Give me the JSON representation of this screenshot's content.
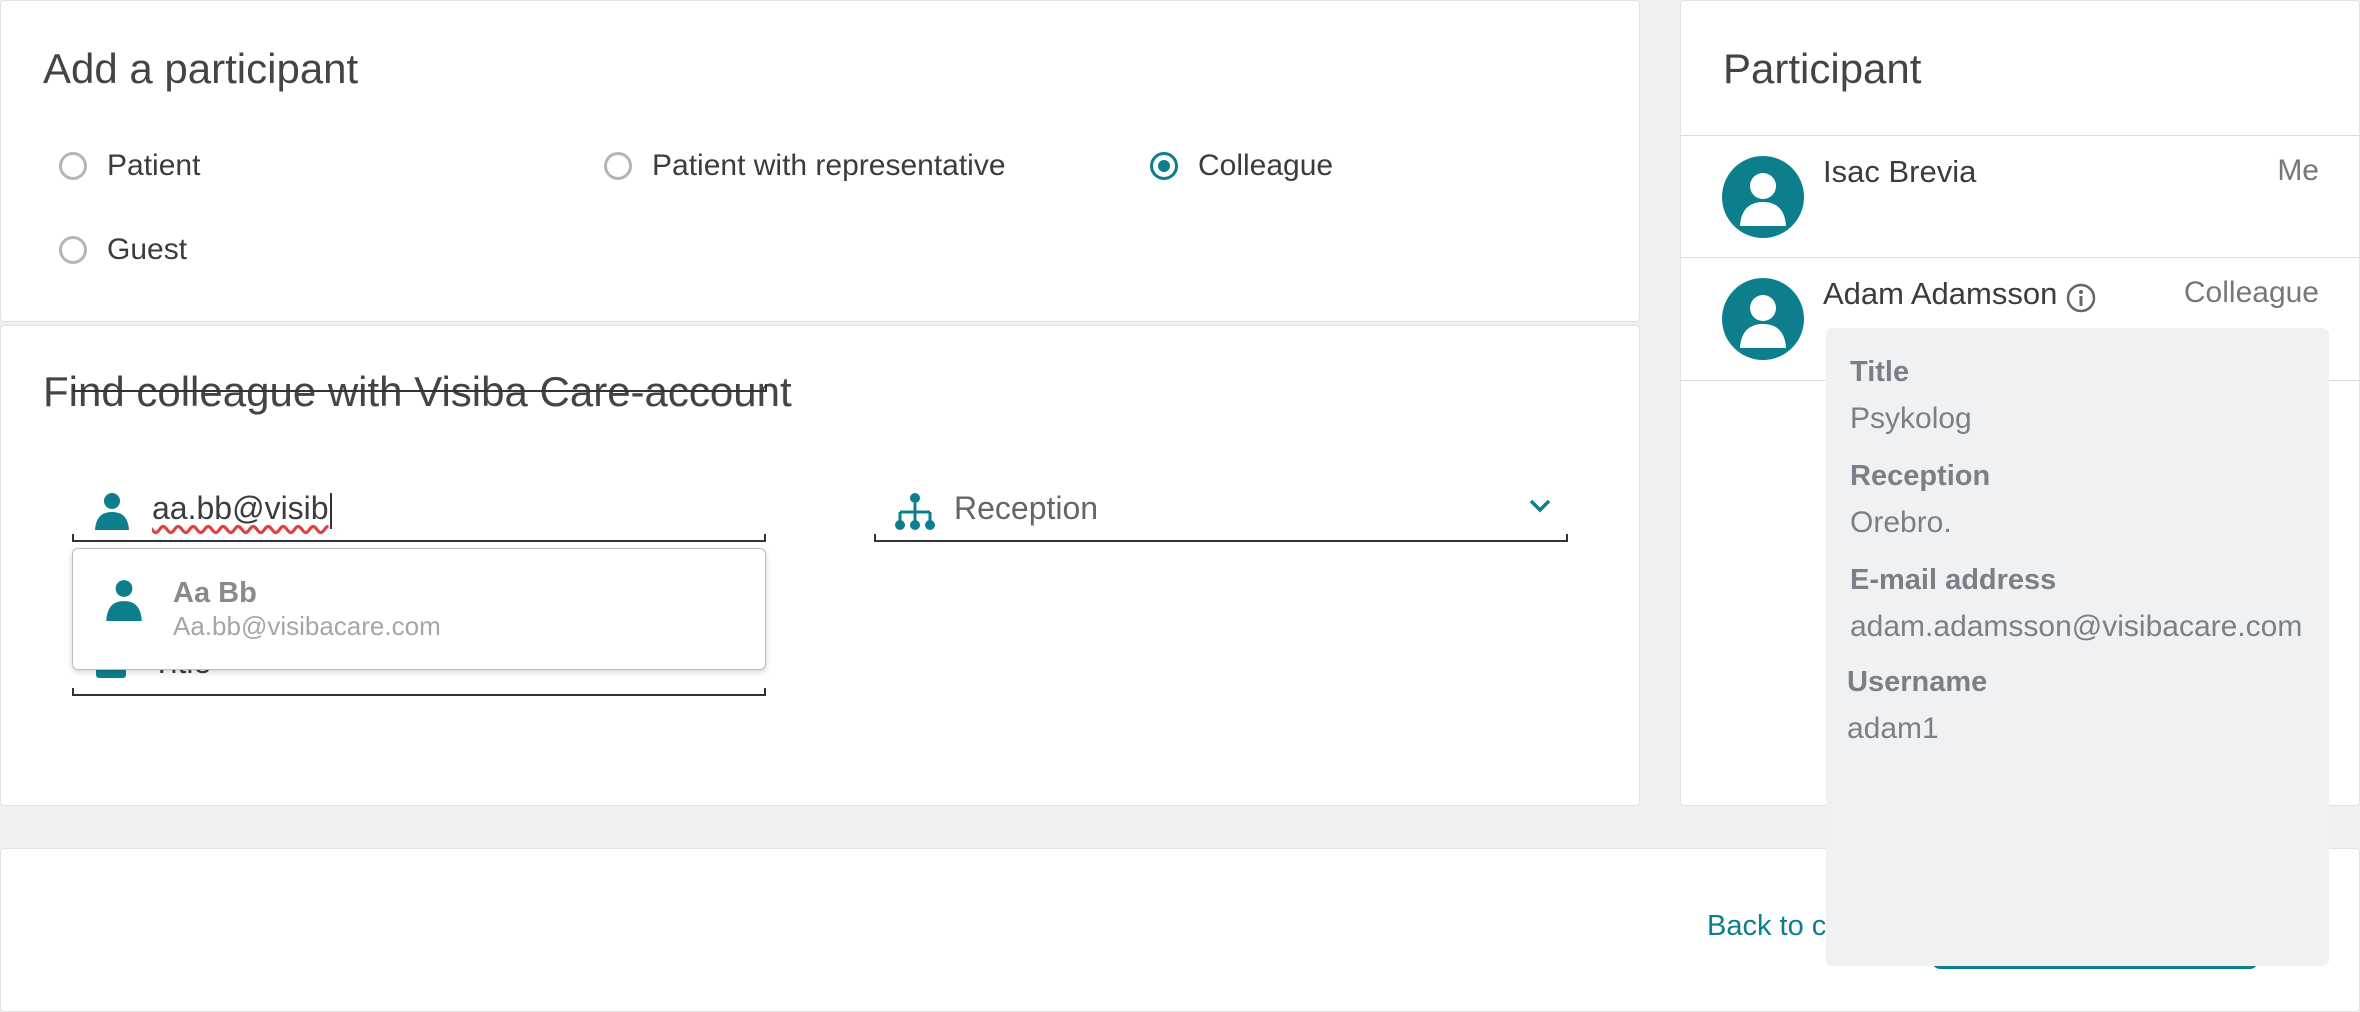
{
  "add_participant": {
    "title": "Add a participant",
    "options": [
      {
        "label": "Patient",
        "selected": false
      },
      {
        "label": "Patient with representative",
        "selected": false
      },
      {
        "label": "Colleague",
        "selected": true
      },
      {
        "label": "Guest",
        "selected": false
      }
    ]
  },
  "find_colleague": {
    "title": "Find colleague with Visiba Care-account",
    "search_value": "aa.bb@visib",
    "reception_placeholder": "Reception",
    "title_field_placeholder": "Title",
    "suggestion": {
      "name": "Aa Bb",
      "email": "Aa.bb@visibacare.com"
    }
  },
  "participants": {
    "title": "Participant",
    "items": [
      {
        "name": "Isac Brevia",
        "role": "Me"
      },
      {
        "name": "Adam Adamsson",
        "role": "Colleague"
      }
    ]
  },
  "tooltip": {
    "title_label": "Title",
    "title_value": "Psykolog",
    "reception_label": "Reception",
    "reception_value": "Orebro.",
    "email_label": "E-mail address",
    "email_value": "adam.adamsson@visibacare.com",
    "username_label": "Username",
    "username_value": "adam1"
  },
  "footer": {
    "back_label": "Back to ca"
  },
  "colors": {
    "accent": "#0d7f8c",
    "background": "#f0f0f0",
    "tooltip_bg": "#f0f1f3"
  }
}
